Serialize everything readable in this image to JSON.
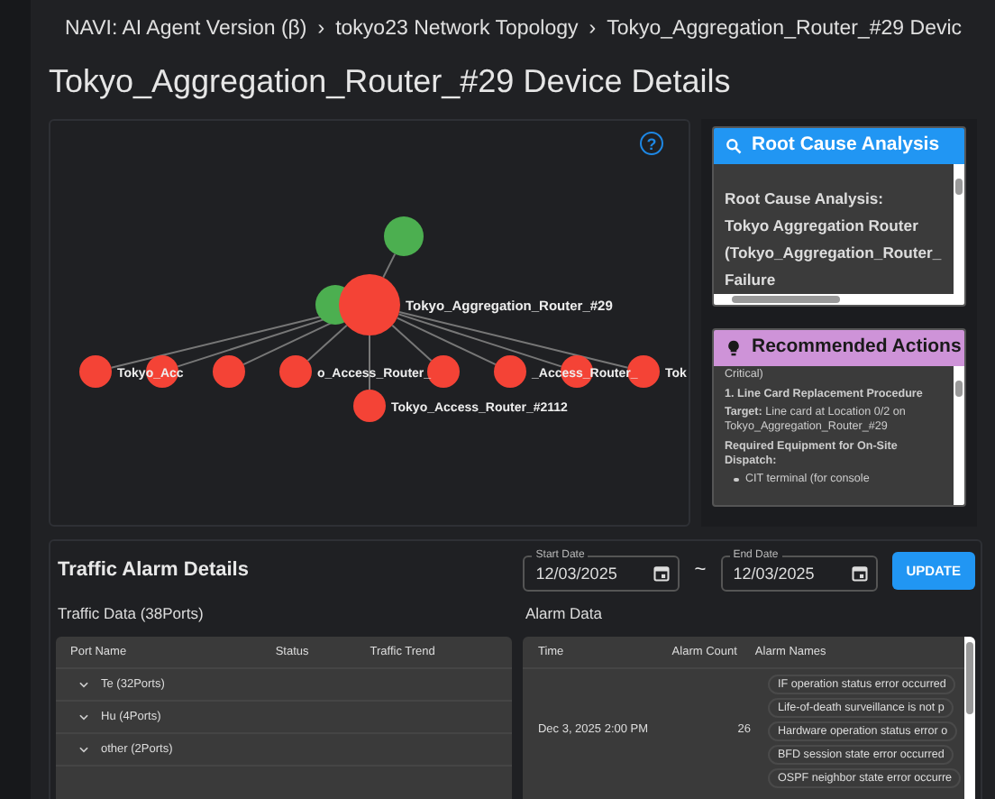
{
  "breadcrumb": {
    "separator": "›",
    "items": [
      "NAVI: AI Agent Version (β)",
      "tokyo23 Network Topology",
      "Tokyo_Aggregation_Router_#29 Devic"
    ]
  },
  "title": "Tokyo_Aggregation_Router_#29 Device Details",
  "topology": {
    "help": "?",
    "nodes": [
      {
        "kind": "hub",
        "color": "#f44336",
        "label": "Tokyo_Aggregation_Router_#29"
      },
      {
        "kind": "uplink",
        "color": "#4caf50"
      },
      {
        "kind": "uplink",
        "color": "#4caf50"
      },
      {
        "kind": "access",
        "color": "#f44336",
        "label": "Tokyo_Acc"
      },
      {
        "kind": "access",
        "color": "#f44336"
      },
      {
        "kind": "access",
        "color": "#f44336"
      },
      {
        "kind": "access",
        "color": "#f44336",
        "label": "o_Access_Router_"
      },
      {
        "kind": "access",
        "color": "#f44336"
      },
      {
        "kind": "access",
        "color": "#f44336",
        "label": "_Access_Router_"
      },
      {
        "kind": "access",
        "color": "#f44336"
      },
      {
        "kind": "access",
        "color": "#f44336",
        "label": "Tok"
      },
      {
        "kind": "below",
        "color": "#f44336",
        "label": "Tokyo_Access_Router_#2112"
      }
    ]
  },
  "root_cause": {
    "title": "Root Cause Analysis",
    "lines": [
      "Root Cause Analysis:",
      "Tokyo Aggregation Router",
      "(Tokyo_Aggregation_Router_",
      "Failure"
    ]
  },
  "recommended": {
    "title": "Recommended Actions",
    "blocks": [
      {
        "kind": "text",
        "text": "Critical)"
      },
      {
        "kind": "heading",
        "text": "1. Line Card Replacement Procedure"
      },
      {
        "kind": "text",
        "text": "**Target:** Line card at Location 0/2 on Tokyo_Aggregation_Router_#29"
      },
      {
        "kind": "heading",
        "text": "Required Equipment for On-Site Dispatch:"
      },
      {
        "kind": "bullet",
        "text": "CIT terminal (for console"
      }
    ]
  },
  "traffic_alarm": {
    "title": "Traffic Alarm Details",
    "start_date": {
      "label": "Start Date",
      "value": "12/03/2025"
    },
    "separator": "~",
    "end_date": {
      "label": "End Date",
      "value": "12/03/2025"
    },
    "update_button": "UPDATE",
    "traffic_data": {
      "title": "Traffic Data (38Ports)",
      "columns": [
        "Port Name",
        "Status",
        "Traffic Trend"
      ],
      "groups": [
        {
          "label": "Te (32Ports)",
          "expanded": false
        },
        {
          "label": "Hu (4Ports)",
          "expanded": false
        },
        {
          "label": "other (2Ports)",
          "expanded": false
        }
      ]
    },
    "alarm_data": {
      "title": "Alarm Data",
      "columns": [
        "Time",
        "Alarm Count",
        "Alarm Names"
      ],
      "rows": [
        {
          "time": "Dec 3, 2025 2:00 PM",
          "count": "26",
          "names": [
            "IF operation status error occurred",
            "Life-of-death surveillance is not p",
            "Hardware operation status error o",
            "BFD session state error occurred",
            "OSPF neighbor state error occurre"
          ]
        }
      ]
    }
  }
}
